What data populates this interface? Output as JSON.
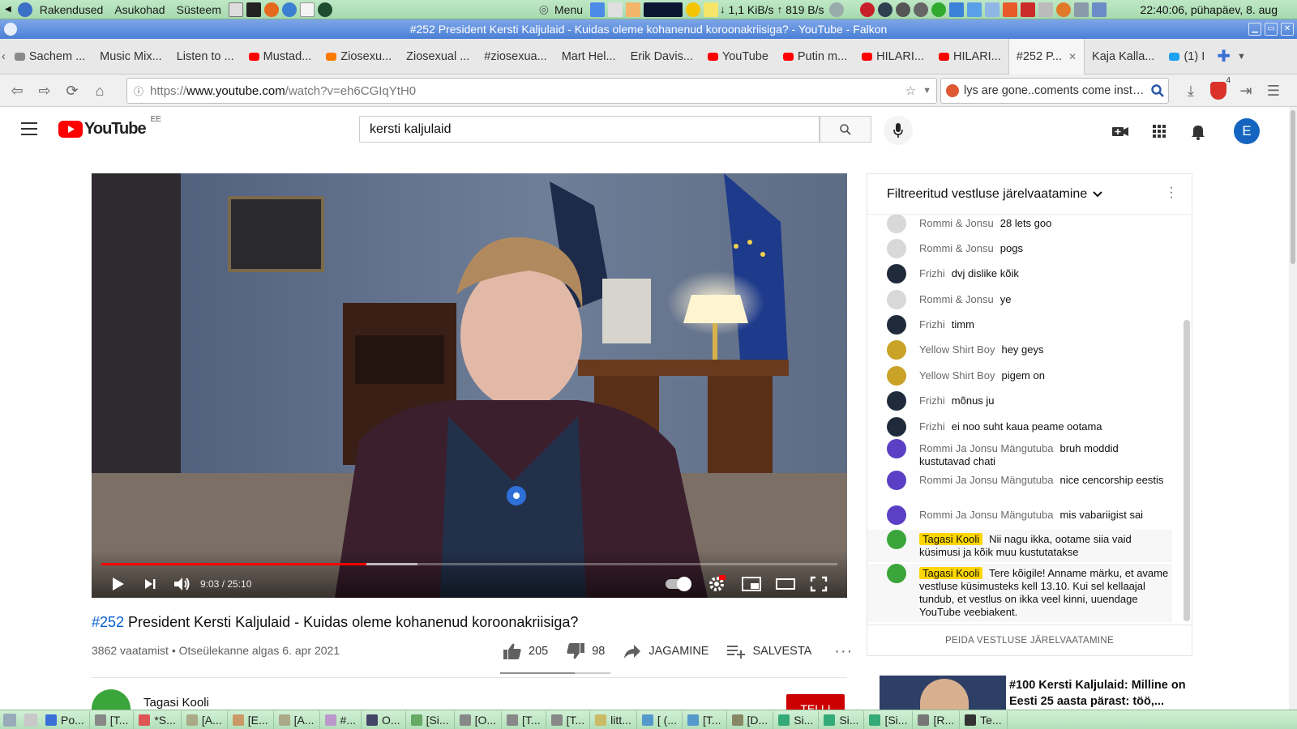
{
  "system_panel": {
    "menus": [
      "Rakendused",
      "Asukohad",
      "Süsteem"
    ],
    "menu_label": "Menu",
    "net_down": "1,1 KiB/s",
    "net_up": "819 B/s",
    "clock": "22:40:06, pühapäev,  8. aug"
  },
  "window": {
    "title": "#252 President Kersti Kaljulaid - Kuidas oleme kohanenud koroonakriisiga? - YouTube - Falkon"
  },
  "tabs": [
    {
      "label": "Sachem ...",
      "fav": "#8a8a8a"
    },
    {
      "label": "Music Mix...",
      "fav": ""
    },
    {
      "label": "Listen to ...",
      "fav": ""
    },
    {
      "label": "Mustad...",
      "fav": "#ff0000"
    },
    {
      "label": "Ziosexu...",
      "fav": "#ff7a00"
    },
    {
      "label": "Ziosexual ...",
      "fav": ""
    },
    {
      "label": "#ziosexua...",
      "fav": ""
    },
    {
      "label": "Mart Hel...",
      "fav": ""
    },
    {
      "label": "Erik Davis...",
      "fav": ""
    },
    {
      "label": "YouTube",
      "fav": "#ff0000"
    },
    {
      "label": "Putin m...",
      "fav": "#ff0000"
    },
    {
      "label": "HILARI...",
      "fav": "#ff0000"
    },
    {
      "label": "HILARI...",
      "fav": "#ff0000"
    },
    {
      "label": "#252 P...",
      "fav": "",
      "active": true
    },
    {
      "label": "Kaja Kalla...",
      "fav": ""
    },
    {
      "label": "(1) I",
      "fav": "#1da1f2"
    }
  ],
  "navbar": {
    "url_prefix": "https://",
    "url_domain": "www.youtube.com",
    "url_path": "/watch?v=eh6CGIqYtH0",
    "search_text": "lys are gone..coments come instant",
    "badge": "4"
  },
  "youtube": {
    "logo_text": "YouTube",
    "country": "EE",
    "search_value": "kersti kaljulaid",
    "avatar_letter": "E"
  },
  "player": {
    "time": "9:03 / 25:10",
    "progress": 0.3606,
    "buffered": 0.43
  },
  "video": {
    "hash": "#252",
    "title": " President Kersti Kaljulaid - Kuidas oleme kohanenud koroonakriisiga?",
    "meta": "3862 vaatamist • Otseülekanne algas 6. apr 2021",
    "likes": "205",
    "dislikes": "98",
    "share": "JAGAMINE",
    "save": "SALVESTA",
    "like_ratio": 0.677
  },
  "channel": {
    "name": "Tagasi Kooli",
    "subscribe": "TELLI"
  },
  "chat": {
    "header": "Filtreeritud vestluse järelvaatamine",
    "footer": "PEIDA VESTLUSE JÄRELVAATAMINE",
    "messages": [
      {
        "author": "Rommi & Jonsu",
        "text": "28 lets goo",
        "av": "#d8d8d8"
      },
      {
        "author": "Rommi & Jonsu",
        "text": "pogs",
        "av": "#d8d8d8"
      },
      {
        "author": "Frizhi",
        "text": "dvj dislike kõik",
        "av": "#1f2b3a"
      },
      {
        "author": "Rommi & Jonsu",
        "text": "ye",
        "av": "#d8d8d8"
      },
      {
        "author": "Frizhi",
        "text": "timm",
        "av": "#1f2b3a"
      },
      {
        "author": "Yellow Shirt Boy",
        "text": "hey geys",
        "av": "#c9a227"
      },
      {
        "author": "Yellow Shirt Boy",
        "text": "pigem on",
        "av": "#c9a227"
      },
      {
        "author": "Frizhi",
        "text": "mõnus ju",
        "av": "#1f2b3a"
      },
      {
        "author": "Frizhi",
        "text": "ei noo suht kaua peame ootama",
        "av": "#1f2b3a"
      },
      {
        "author": "Rommi Ja Jonsu Mängutuba",
        "text": "bruh moddid kustutavad chati",
        "av": "#5b3fc4"
      },
      {
        "author": "Rommi Ja Jonsu Mängutuba",
        "text": "nice cencorship eestis",
        "av": "#5b3fc4"
      },
      {
        "author": "Rommi Ja Jonsu Mängutuba",
        "text": "mis vabariigist sai",
        "av": "#5b3fc4"
      },
      {
        "author": "Tagasi Kooli",
        "text": "Nii nagu ikka, ootame siia vaid küsimusi ja kõik muu kustutatakse",
        "av": "#3aa53a",
        "owner": true
      },
      {
        "author": "Tagasi Kooli",
        "text": "Tere kõigile! Anname märku, et avame vestluse küsimusteks kell 13.10. Kui sel kellaajal tundub, et vestlus on ikka veel kinni, uuendage YouTube veebiakent.",
        "av": "#3aa53a",
        "owner": true
      }
    ]
  },
  "recommended": {
    "title": "#100 Kersti Kaljulaid: Milline on Eesti 25 aasta pärast: töö,..."
  },
  "taskbar": [
    "Po...",
    "[T...",
    "*S...",
    "[A...",
    "[E...",
    "[A...",
    "#...",
    "O...",
    "[Si...",
    "[O...",
    "[T...",
    "[T...",
    "litt...",
    "[ (...",
    "[T...",
    "[D...",
    "Si...",
    "Si...",
    "[Si...",
    "[R...",
    "Te..."
  ],
  "colors": {
    "accent": "#ff0000",
    "link": "#065fd4",
    "owner_badge": "#ffd600",
    "titlebar": "#4a7fd6"
  }
}
